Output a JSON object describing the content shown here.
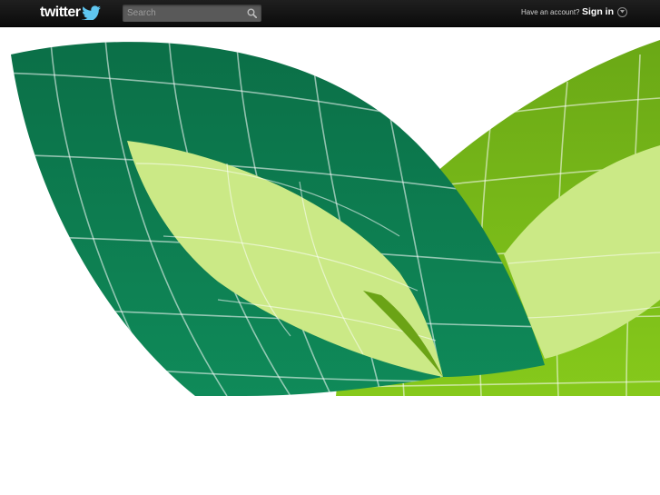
{
  "header": {
    "logo_text": "twitter",
    "search": {
      "placeholder": "Search",
      "value": ""
    },
    "account_prompt": "Have an account?",
    "signin_label": "Sign in"
  },
  "icons": {
    "logo_bird": "bird-icon",
    "search": "search-icon",
    "signin_caret": "chevron-down-icon"
  },
  "colors": {
    "topbar": "#121212",
    "leaf_dark_green": "#0d7a4f",
    "leaf_lime": "#7fbe1c",
    "leaf_pale": "#cbe986",
    "grid_lines": "#ffffff"
  }
}
